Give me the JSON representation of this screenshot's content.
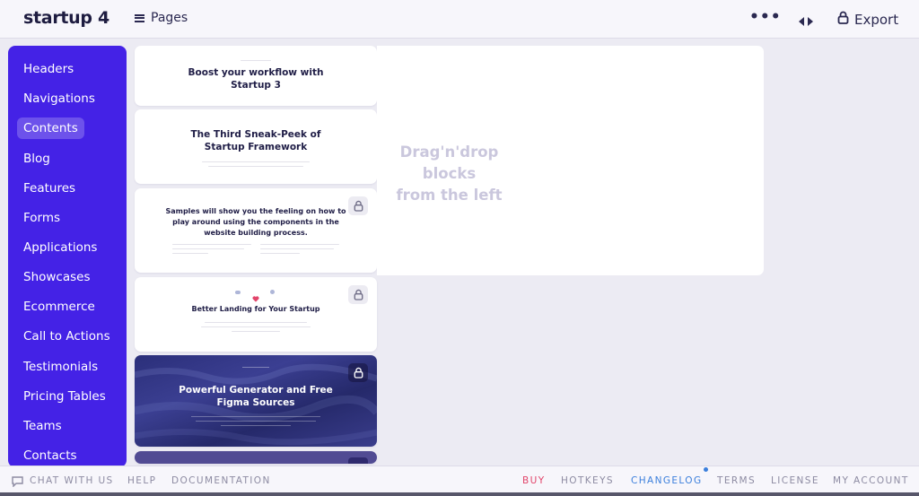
{
  "app": {
    "brand": "startup 4"
  },
  "topbar": {
    "pages_label": "Pages",
    "more_label": "•••",
    "export_label": "Export"
  },
  "sidebar": {
    "items": [
      {
        "label": "Headers"
      },
      {
        "label": "Navigations"
      },
      {
        "label": "Contents",
        "active": true
      },
      {
        "label": "Blog"
      },
      {
        "label": "Features"
      },
      {
        "label": "Forms"
      },
      {
        "label": "Applications"
      },
      {
        "label": "Showcases"
      },
      {
        "label": "Ecommerce"
      },
      {
        "label": "Call to Actions"
      },
      {
        "label": "Testimonials"
      },
      {
        "label": "Pricing Tables"
      },
      {
        "label": "Teams"
      },
      {
        "label": "Contacts"
      }
    ]
  },
  "blocks": [
    {
      "title_line1": "Boost your workflow with",
      "title_line2": "Startup 3"
    },
    {
      "title_line1": "The Third Sneak-Peek of",
      "title_line2": "Startup Framework"
    },
    {
      "title_line1": "Samples will show you the feeling on how to",
      "title_line2": "play around using the components in the",
      "title_line3": "website building process."
    },
    {
      "title_line1": "Better Landing for Your Startup"
    },
    {
      "title_line1": "Powerful Generator and Free",
      "title_line2": "Figma Sources"
    }
  ],
  "canvas": {
    "drop_line1": "Drag'n'drop blocks",
    "drop_line2": "from the left"
  },
  "footer": {
    "chat": "CHAT WITH US",
    "help": "HELP",
    "documentation": "DOCUMENTATION",
    "buy": "BUY",
    "hotkeys": "HOTKEYS",
    "changelog": "CHANGELOG",
    "terms": "TERMS",
    "license": "LICENSE",
    "account": "MY ACCOUNT"
  },
  "colors": {
    "sidebar": "#4422e6",
    "buy": "#e2456b",
    "changelog": "#3b7fdc",
    "heading": "#1f1d46"
  },
  "icons": [
    "menu-icon",
    "more-icon",
    "expand-arrows-icon",
    "lock-icon",
    "chat-icon",
    "heart-icon"
  ]
}
